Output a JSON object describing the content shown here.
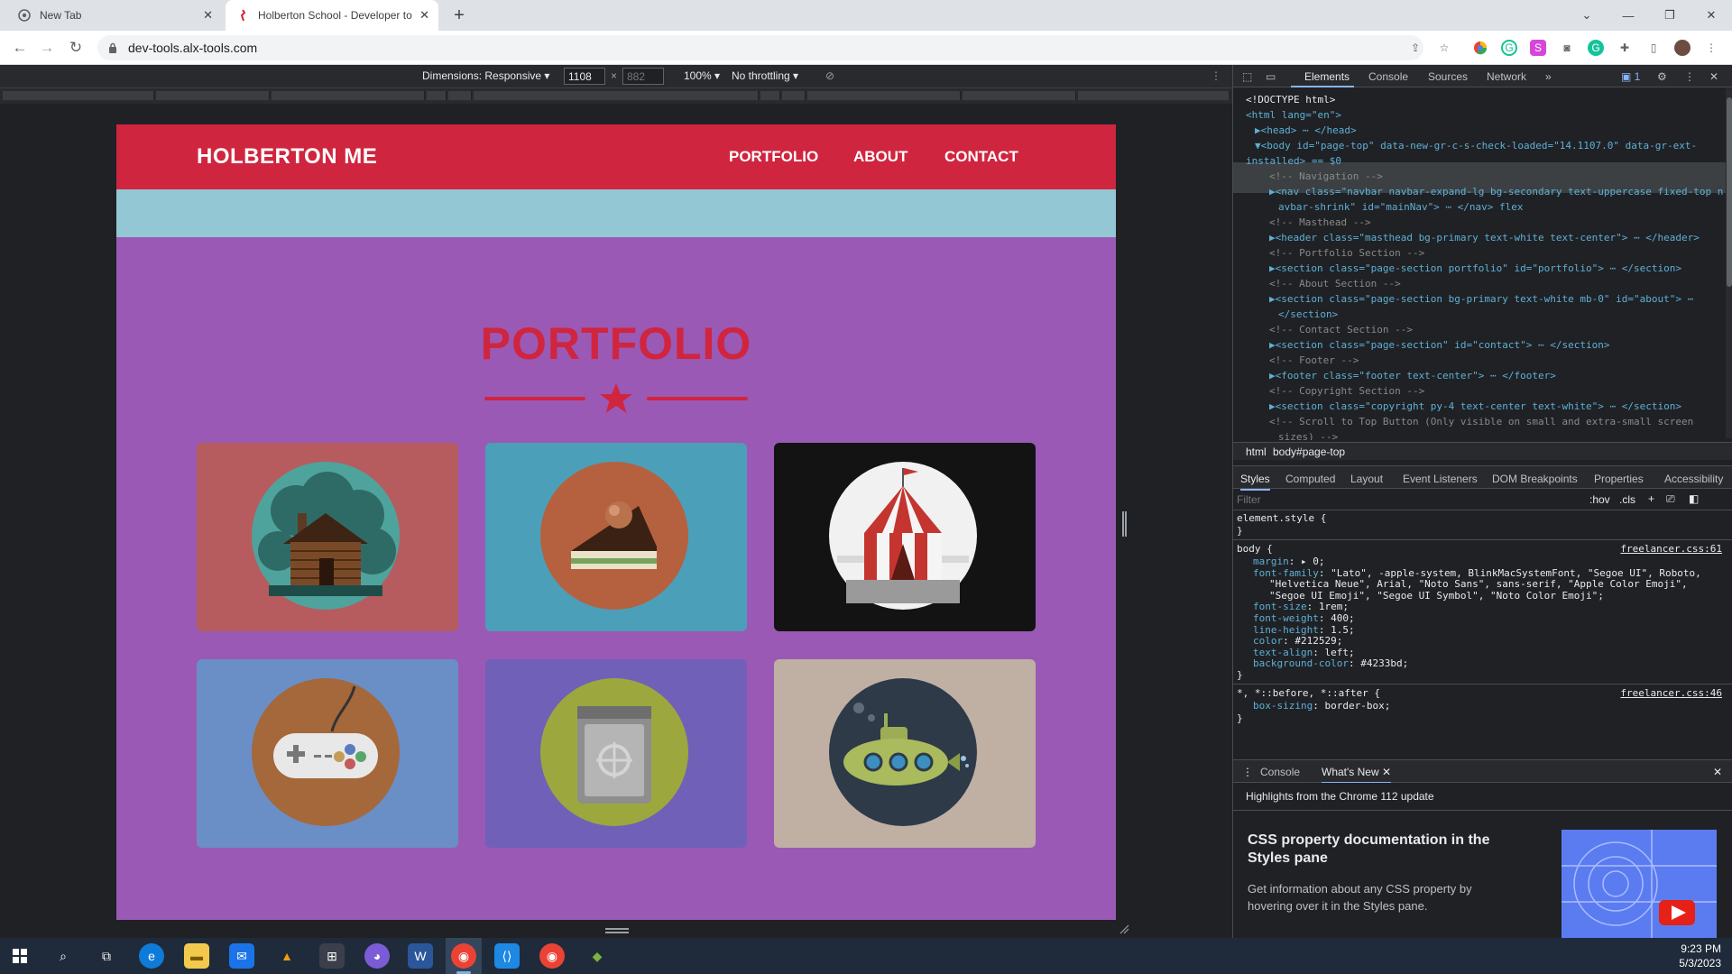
{
  "browser": {
    "tabs": [
      {
        "title": "New Tab",
        "active": false
      },
      {
        "title": "Holberton School - Developer to",
        "active": true
      }
    ],
    "url": "dev-tools.alx-tools.com"
  },
  "device_toolbar": {
    "dimensions_label": "Dimensions: Responsive",
    "width": "1108",
    "times": "×",
    "height_placeholder": "882",
    "zoom": "100%",
    "throttling": "No throttling"
  },
  "site": {
    "brand": "HOLBERTON ME",
    "nav_links": [
      "PORTFOLIO",
      "ABOUT",
      "CONTACT"
    ],
    "portfolio_heading": "PORTFOLIO",
    "colors": {
      "nav": "#d0253f",
      "masthead": "#93c7d3",
      "background": "#9b59b6"
    },
    "portfolio_items": [
      {
        "name": "cabin",
        "bg": "#b65c5f"
      },
      {
        "name": "cake",
        "bg": "#4c9fb9"
      },
      {
        "name": "circus",
        "bg": "#141314"
      },
      {
        "name": "game-controller",
        "bg": "#6a8fc6"
      },
      {
        "name": "safe",
        "bg": "#7160b7"
      },
      {
        "name": "submarine",
        "bg": "#c0b0a4"
      }
    ]
  },
  "devtools": {
    "tabs": [
      "Elements",
      "Console",
      "Sources",
      "Network"
    ],
    "issues_count": "1",
    "breadcrumbs": [
      "html",
      "body#page-top"
    ],
    "styles_tabs": [
      "Styles",
      "Computed",
      "Layout",
      "Event Listeners",
      "DOM Breakpoints",
      "Properties",
      "Accessibility"
    ],
    "filter_placeholder": "Filter",
    "hov": ":hov",
    "cls": ".cls",
    "dom_lines": [
      {
        "indent": 0,
        "kind": "doctype",
        "text": "<!DOCTYPE html>"
      },
      {
        "indent": 0,
        "kind": "tag",
        "text": "<html lang=\"en\">"
      },
      {
        "indent": 1,
        "kind": "tag",
        "text": "▶<head> ⋯ </head>"
      },
      {
        "indent": 1,
        "kind": "sel",
        "text": "▼<body id=\"page-top\" data-new-gr-c-s-check-loaded=\"14.1107.0\" data-gr-ext-"
      },
      {
        "indent": 1,
        "kind": "sel2",
        "text": "installed> == $0"
      },
      {
        "indent": 2,
        "kind": "comment",
        "text": "<!-- Navigation -->"
      },
      {
        "indent": 2,
        "kind": "tag",
        "text": "▶<nav class=\"navbar navbar-expand-lg bg-secondary text-uppercase fixed-top n"
      },
      {
        "indent": 2,
        "kind": "tag2",
        "text": "avbar-shrink\" id=\"mainNav\"> ⋯ </nav>  flex"
      },
      {
        "indent": 2,
        "kind": "comment",
        "text": "<!-- Masthead -->"
      },
      {
        "indent": 2,
        "kind": "tag",
        "text": "▶<header class=\"masthead bg-primary text-white text-center\"> ⋯ </header>"
      },
      {
        "indent": 2,
        "kind": "comment",
        "text": "<!-- Portfolio Section -->"
      },
      {
        "indent": 2,
        "kind": "tag",
        "text": "▶<section class=\"page-section portfolio\" id=\"portfolio\"> ⋯ </section>"
      },
      {
        "indent": 2,
        "kind": "comment",
        "text": "<!-- About Section -->"
      },
      {
        "indent": 2,
        "kind": "tag",
        "text": "▶<section class=\"page-section bg-primary text-white mb-0\" id=\"about\"> ⋯"
      },
      {
        "indent": 2,
        "kind": "tag2",
        "text": "</section>"
      },
      {
        "indent": 2,
        "kind": "comment",
        "text": "<!-- Contact Section -->"
      },
      {
        "indent": 2,
        "kind": "tag",
        "text": "▶<section class=\"page-section\" id=\"contact\"> ⋯ </section>"
      },
      {
        "indent": 2,
        "kind": "comment",
        "text": "<!-- Footer -->"
      },
      {
        "indent": 2,
        "kind": "tag",
        "text": "▶<footer class=\"footer text-center\"> ⋯ </footer>"
      },
      {
        "indent": 2,
        "kind": "comment",
        "text": "<!-- Copyright Section -->"
      },
      {
        "indent": 2,
        "kind": "tag",
        "text": "▶<section class=\"copyright py-4 text-center text-white\"> ⋯ </section>"
      },
      {
        "indent": 2,
        "kind": "comment",
        "text": "<!-- Scroll to Top Button (Only visible on small and extra-small screen"
      },
      {
        "indent": 2,
        "kind": "comment2",
        "text": "sizes) -->"
      }
    ],
    "styles": {
      "element_style": "element.style {",
      "close": "}",
      "body_selector": "body {",
      "body_source": "freelancer.css:61",
      "body_props": [
        {
          "p": "margin",
          "v": "▸ 0;"
        },
        {
          "p": "font-family",
          "v": "\"Lato\", -apple-system, BlinkMacSystemFont, \"Segoe UI\", Roboto,"
        },
        {
          "p": "",
          "v": "\"Helvetica Neue\", Arial, \"Noto Sans\", sans-serif, \"Apple Color Emoji\","
        },
        {
          "p": "",
          "v": "\"Segoe UI Emoji\", \"Segoe UI Symbol\", \"Noto Color Emoji\";"
        },
        {
          "p": "font-size",
          "v": "1rem;"
        },
        {
          "p": "font-weight",
          "v": "400;"
        },
        {
          "p": "line-height",
          "v": "1.5;"
        },
        {
          "p": "color",
          "v": "#212529;"
        },
        {
          "p": "text-align",
          "v": "left;"
        },
        {
          "p": "background-color",
          "v": "#4233bd;"
        }
      ],
      "star_selector": "*, *::before, *::after {",
      "star_source": "freelancer.css:46",
      "star_props": [
        {
          "p": "box-sizing",
          "v": "border-box;"
        }
      ]
    },
    "drawer": {
      "tabs": [
        "Console",
        "What's New"
      ],
      "highlight": "Highlights from the Chrome 112 update",
      "headline": "CSS property documentation in the Styles pane",
      "body": "Get information about any CSS property by hovering over it in the Styles pane."
    }
  },
  "taskbar": {
    "time": "9:23 PM",
    "date": "5/3/2023"
  }
}
